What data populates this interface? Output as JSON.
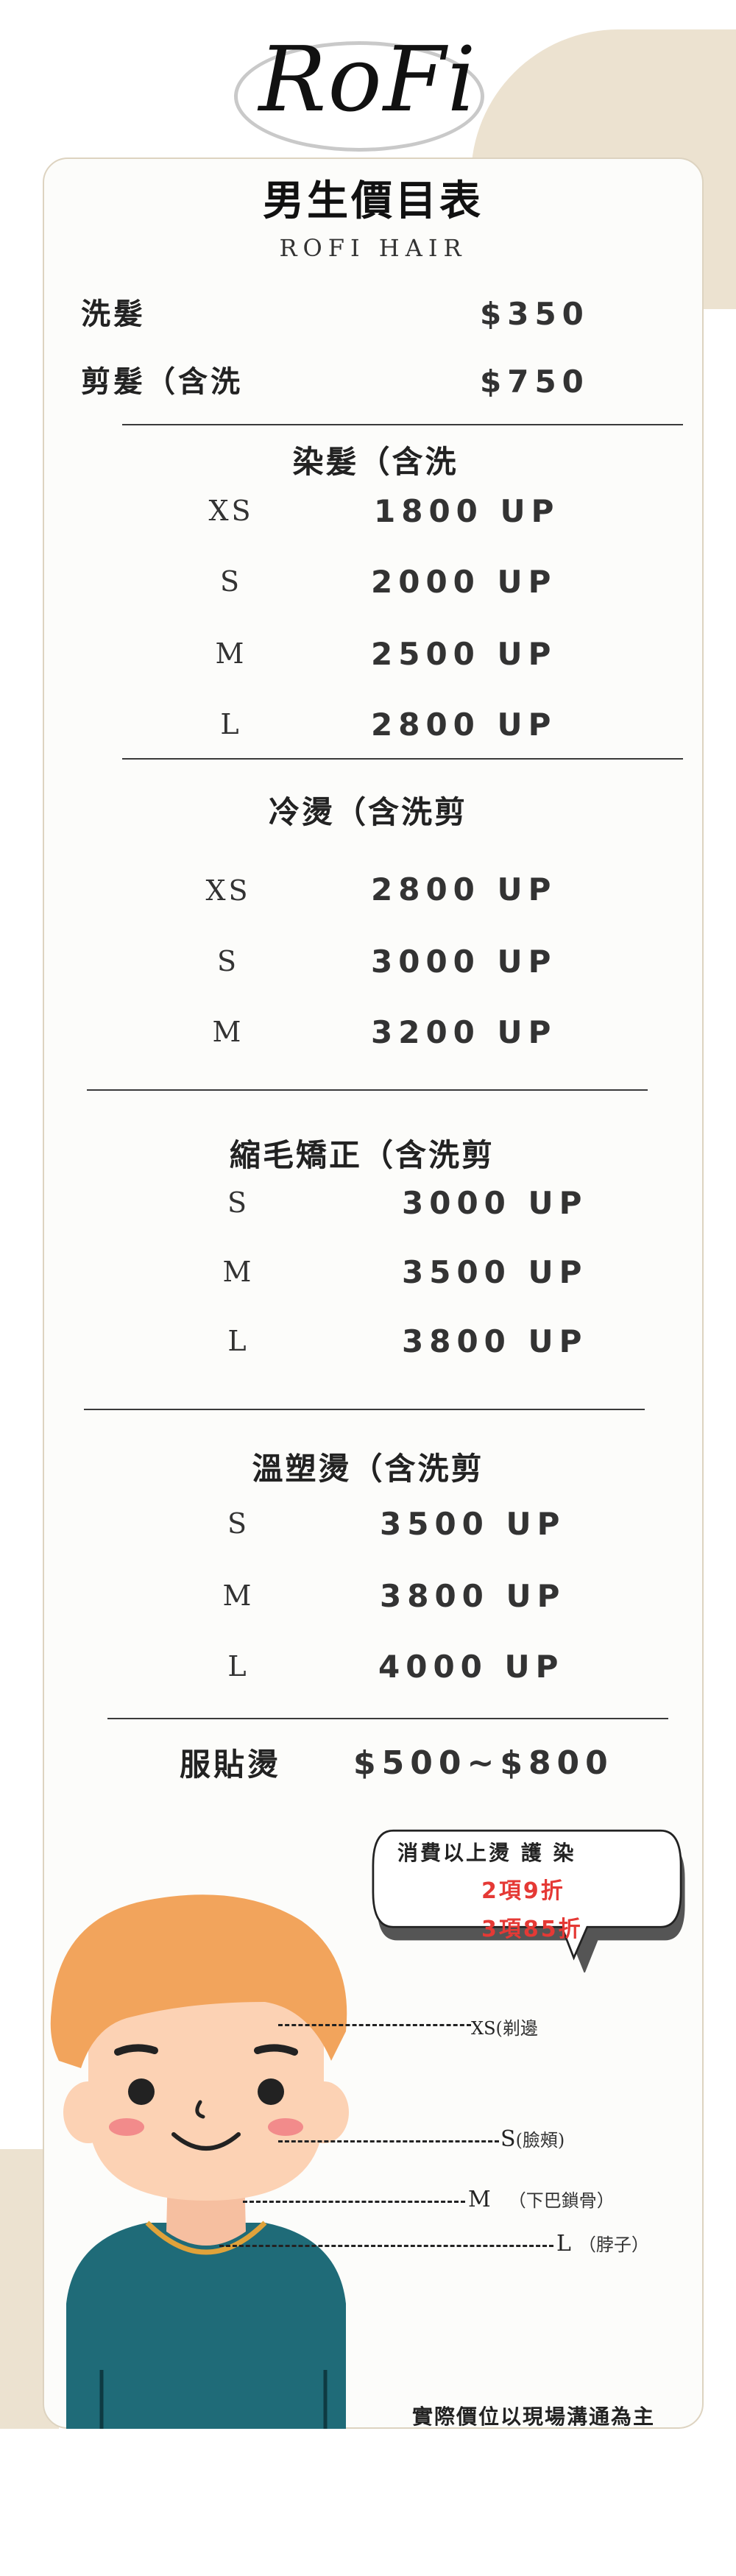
{
  "brand": {
    "logo_text": "RoFi",
    "subtitle": "ROFI HAIR"
  },
  "title": "男生價目表",
  "basic": [
    {
      "label": "洗髮",
      "price": "$350"
    },
    {
      "label": "剪髮（含洗",
      "price": "$750"
    }
  ],
  "sections": [
    {
      "title": "染髮（含洗",
      "rows": [
        {
          "size": "XS",
          "price": "1800 UP"
        },
        {
          "size": "S",
          "price": "2000 UP"
        },
        {
          "size": "M",
          "price": "2500 UP"
        },
        {
          "size": "L",
          "price": "2800 UP"
        }
      ]
    },
    {
      "title": "冷燙（含洗剪",
      "rows": [
        {
          "size": "XS",
          "price": "2800 UP"
        },
        {
          "size": "S",
          "price": "3000 UP"
        },
        {
          "size": "M",
          "price": "3200 UP"
        }
      ]
    },
    {
      "title": "縮毛矯正（含洗剪",
      "rows": [
        {
          "size": "S",
          "price": "3000 UP"
        },
        {
          "size": "M",
          "price": "3500 UP"
        },
        {
          "size": "L",
          "price": "3800 UP"
        }
      ]
    },
    {
      "title": "溫塑燙（含洗剪",
      "rows": [
        {
          "size": "S",
          "price": "3500 UP"
        },
        {
          "size": "M",
          "price": "3800 UP"
        },
        {
          "size": "L",
          "price": "4000 UP"
        }
      ]
    }
  ],
  "extra": {
    "label": "服貼燙",
    "price": "$500~$800"
  },
  "promo": {
    "line1": "消費以上燙 護 染",
    "line2": "2項9折",
    "line3": "3項85折",
    "accent_color": "#e53935"
  },
  "measure": [
    {
      "size": "XS",
      "note": "(剃邊"
    },
    {
      "size": "S",
      "note": "(臉頰)"
    },
    {
      "size": "M",
      "note": "（下巴鎖骨）"
    },
    {
      "size": "L",
      "note": "（脖子）"
    }
  ],
  "disclaimer": "實際價位以現場溝通為主",
  "colors": {
    "beige": "#ece2d0",
    "hair": "#f2a45c",
    "skin": "#fcd2b4",
    "shirt": "#1f6b78",
    "necklace": "#e0a23a"
  }
}
